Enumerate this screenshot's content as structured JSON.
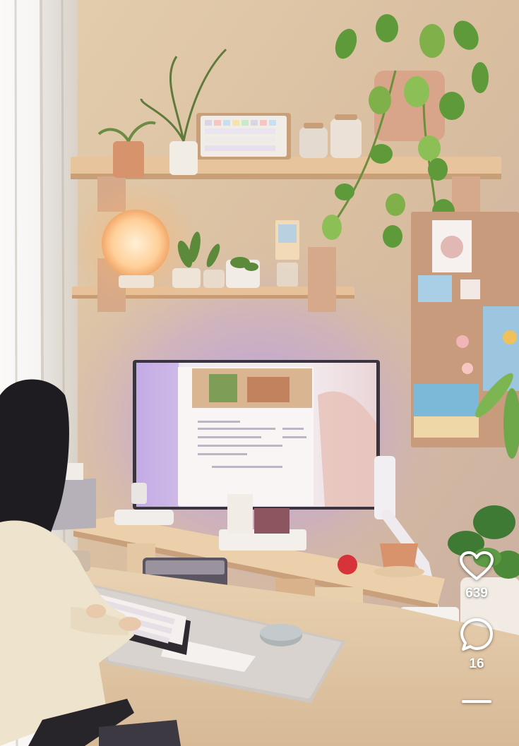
{
  "actions": {
    "likes": "639",
    "comments": "16"
  },
  "icons": [
    "heart-icon",
    "comment-icon",
    "share-icon"
  ],
  "colors": {
    "wall": "#dcc4a3",
    "shelf": "#e7c49e",
    "desk": "#e2c8a6",
    "lamp_glow": "#ffd3a1",
    "purple_light": "#b9a2e6",
    "icon": "#ffffff"
  }
}
